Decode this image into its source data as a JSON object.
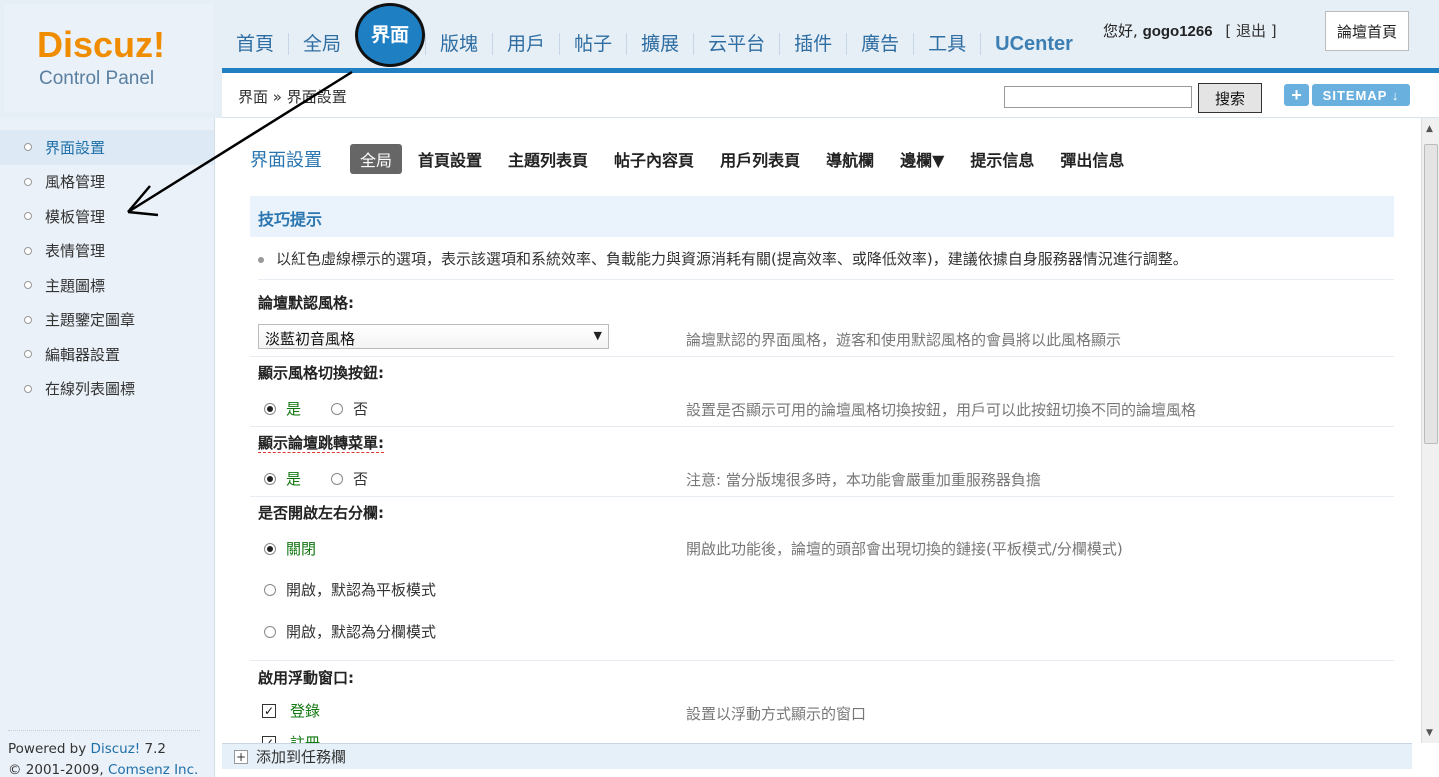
{
  "logo": {
    "brand": "Discuz!",
    "subtitle": "Control Panel"
  },
  "topnav": {
    "items": [
      "首頁",
      "全局",
      "界面",
      "版塊",
      "用戶",
      "帖子",
      "擴展",
      "云平台",
      "插件",
      "廣告",
      "工具",
      "UCenter"
    ],
    "active_index": 2
  },
  "user": {
    "greeting": "您好,",
    "name": "gogo1266",
    "logout": "[ 退出 ]",
    "home_button": "論壇首頁"
  },
  "breadcrumb": "界面 » 界面設置",
  "search": {
    "button": "搜索"
  },
  "shortcut": {
    "plus": "+",
    "sitemap": "SITEMAP ↓"
  },
  "sidebar": {
    "items": [
      "界面設置",
      "風格管理",
      "模板管理",
      "表情管理",
      "主題圖標",
      "主題鑒定圖章",
      "編輯器設置",
      "在線列表圖標"
    ],
    "active_index": 0,
    "powered_prefix": "Powered by ",
    "powered_brand": "Discuz!",
    "powered_version": " 7.2",
    "copyright_prefix": "© 2001-2009, ",
    "copyright_company": "Comsenz Inc."
  },
  "main": {
    "title": "界面設置",
    "tabs": [
      "全局",
      "首頁設置",
      "主題列表頁",
      "帖子內容頁",
      "用戶列表頁",
      "導航欄",
      "邊欄▼",
      "提示信息",
      "彈出信息"
    ],
    "active_tab": 0,
    "tip_title": "技巧提示",
    "tip_text": "以紅色虛線標示的選項，表示該選項和系統效率、負載能力與資源消耗有關(提高效率、或降低效率)，建議依據自身服務器情況進行調整。"
  },
  "settings": {
    "style": {
      "label": "論壇默認風格:",
      "value": "淡藍初音風格",
      "hint": "論壇默認的界面風格，遊客和使用默認風格的會員將以此風格顯示"
    },
    "style_switch": {
      "label": "顯示風格切換按鈕:",
      "yes": "是",
      "no": "否",
      "hint": "設置是否顯示可用的論壇風格切換按鈕，用戶可以此按鈕切換不同的論壇風格"
    },
    "jump_menu": {
      "label": "顯示論壇跳轉菜單:",
      "yes": "是",
      "no": "否",
      "hint": "注意: 當分版塊很多時，本功能會嚴重加重服務器負擔"
    },
    "split": {
      "label": "是否開啟左右分欄:",
      "opt_close": "關閉",
      "opt_flat": "開啟，默認為平板模式",
      "opt_split": "開啟，默認為分欄模式",
      "hint": "開啟此功能後，論壇的頭部會出現切換的鏈接(平板模式/分欄模式)"
    },
    "float": {
      "label": "啟用浮動窗口:",
      "opt_login": "登錄",
      "opt_register": "註冊",
      "hint": "設置以浮動方式顯示的窗口"
    }
  },
  "taskbar": {
    "plus": "+",
    "label": "添加到任務欄"
  }
}
